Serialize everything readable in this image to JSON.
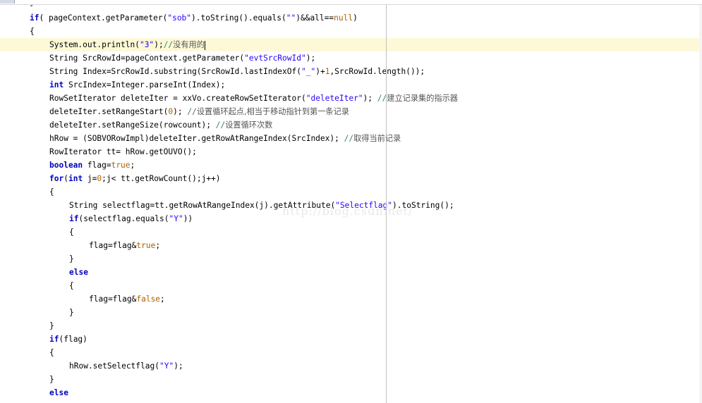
{
  "editor": {
    "top_partial": "}",
    "watermark": "http://blog.csdn.net/",
    "lines": [
      {
        "indent": 42,
        "parts": [
          [
            "kw",
            "if"
          ],
          [
            "",
            "( pageContext.getParameter("
          ],
          [
            "str",
            "\"sob\""
          ],
          [
            "",
            ").toString().equals("
          ],
          [
            "str",
            "\"\""
          ],
          [
            "",
            ")&&all=="
          ],
          [
            "lit",
            "null"
          ],
          [
            "",
            ")"
          ]
        ]
      },
      {
        "indent": 42,
        "parts": [
          [
            "",
            "{"
          ]
        ]
      },
      {
        "indent": 70,
        "current": true,
        "parts": [
          [
            "",
            "System.out.println("
          ],
          [
            "str",
            "\"3\""
          ],
          [
            "",
            ");"
          ],
          [
            "cm",
            "//"
          ],
          [
            "cm-cn",
            "没有用的"
          ]
        ]
      },
      {
        "indent": 70,
        "parts": [
          [
            "",
            "String SrcRowId=pageContext.getParameter("
          ],
          [
            "str",
            "\"evtSrcRowId\""
          ],
          [
            "",
            ");"
          ]
        ]
      },
      {
        "indent": 70,
        "parts": [
          [
            "",
            "String Index=SrcRowId.substring(SrcRowId.lastIndexOf("
          ],
          [
            "str",
            "\"_\""
          ],
          [
            "",
            ")+"
          ],
          [
            "lit",
            "1"
          ],
          [
            "",
            ",SrcRowId.length());"
          ]
        ]
      },
      {
        "indent": 70,
        "parts": [
          [
            "kw",
            "int"
          ],
          [
            "",
            " SrcIndex=Integer.parseInt(Index);"
          ]
        ]
      },
      {
        "indent": 70,
        "parts": [
          [
            "",
            "RowSetIterator deleteIter = xxVo.createRowSetIterator("
          ],
          [
            "str",
            "\"deleteIter\""
          ],
          [
            "",
            "); "
          ],
          [
            "cm",
            "//"
          ],
          [
            "cm-cn",
            "建立记录集的指示器"
          ]
        ]
      },
      {
        "indent": 70,
        "parts": [
          [
            "",
            "deleteIter.setRangeStart("
          ],
          [
            "lit",
            "0"
          ],
          [
            "",
            "); "
          ],
          [
            "cm",
            "//"
          ],
          [
            "cm-cn",
            "设置循环起点,相当于移动指针到第一条记录"
          ]
        ]
      },
      {
        "indent": 70,
        "parts": [
          [
            "",
            "deleteIter.setRangeSize(rowcount); "
          ],
          [
            "cm",
            "//"
          ],
          [
            "cm-cn",
            "设置循环次数"
          ]
        ]
      },
      {
        "indent": 70,
        "parts": [
          [
            "",
            "hRow = (SOBVORowImpl)deleteIter.getRowAtRangeIndex(SrcIndex); "
          ],
          [
            "cm",
            "//"
          ],
          [
            "cm-cn",
            "取得当前记录"
          ]
        ]
      },
      {
        "indent": 70,
        "parts": [
          [
            "",
            "RowIterator tt= hRow.getOUVO();"
          ]
        ]
      },
      {
        "indent": 70,
        "parts": [
          [
            "kw",
            "boolean"
          ],
          [
            "",
            " flag="
          ],
          [
            "lit",
            "true"
          ],
          [
            "",
            ";"
          ]
        ]
      },
      {
        "indent": 70,
        "parts": [
          [
            "kw",
            "for"
          ],
          [
            "",
            "("
          ],
          [
            "kw",
            "int"
          ],
          [
            "",
            " j="
          ],
          [
            "lit",
            "0"
          ],
          [
            "",
            ";j< tt.getRowCount();j++)"
          ]
        ]
      },
      {
        "indent": 70,
        "parts": [
          [
            "",
            "{"
          ]
        ]
      },
      {
        "indent": 98,
        "parts": [
          [
            "",
            "String selectflag=tt.getRowAtRangeIndex(j).getAttribute("
          ],
          [
            "str",
            "\"Selectflag\""
          ],
          [
            "",
            ").toString();"
          ]
        ]
      },
      {
        "indent": 98,
        "parts": [
          [
            "kw",
            "if"
          ],
          [
            "",
            "(selectflag.equals("
          ],
          [
            "str",
            "\"Y\""
          ],
          [
            "",
            "))"
          ]
        ]
      },
      {
        "indent": 98,
        "parts": [
          [
            "",
            "{"
          ]
        ]
      },
      {
        "indent": 126,
        "parts": [
          [
            "",
            "flag=flag&"
          ],
          [
            "lit",
            "true"
          ],
          [
            "",
            ";"
          ]
        ]
      },
      {
        "indent": 98,
        "parts": [
          [
            "",
            "}"
          ]
        ]
      },
      {
        "indent": 98,
        "parts": [
          [
            "kw",
            "else"
          ]
        ]
      },
      {
        "indent": 98,
        "parts": [
          [
            "",
            "{"
          ]
        ]
      },
      {
        "indent": 126,
        "parts": [
          [
            "",
            "flag=flag&"
          ],
          [
            "lit",
            "false"
          ],
          [
            "",
            ";"
          ]
        ]
      },
      {
        "indent": 98,
        "parts": [
          [
            "",
            "}"
          ]
        ]
      },
      {
        "indent": 70,
        "parts": [
          [
            "",
            "}"
          ]
        ]
      },
      {
        "indent": 70,
        "parts": [
          [
            "kw",
            "if"
          ],
          [
            "",
            "(flag)"
          ]
        ]
      },
      {
        "indent": 70,
        "parts": [
          [
            "",
            "{"
          ]
        ]
      },
      {
        "indent": 98,
        "parts": [
          [
            "",
            "hRow.setSelectflag("
          ],
          [
            "str",
            "\"Y\""
          ],
          [
            "",
            ");"
          ]
        ]
      },
      {
        "indent": 70,
        "parts": [
          [
            "",
            "}"
          ]
        ]
      },
      {
        "indent": 70,
        "parts": [
          [
            "kw",
            "else"
          ]
        ]
      }
    ]
  }
}
